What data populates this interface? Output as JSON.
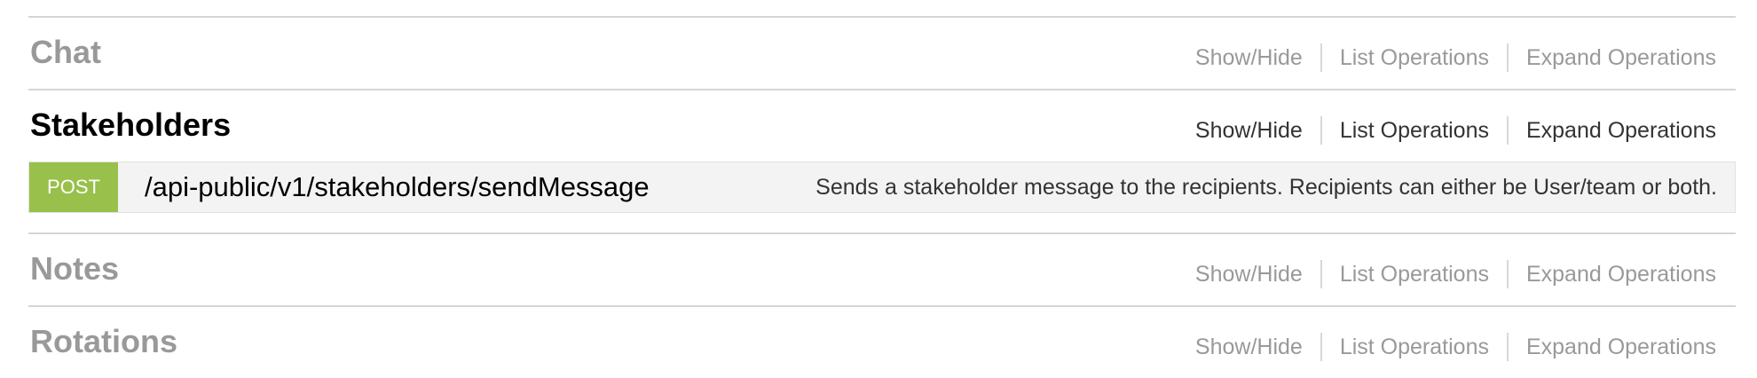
{
  "resources": [
    {
      "title": "Chat",
      "options": {
        "show_hide": "Show/Hide",
        "list_operations": "List Operations",
        "expand_operations": "Expand Operations"
      }
    },
    {
      "title": "Stakeholders",
      "options": {
        "show_hide": "Show/Hide",
        "list_operations": "List Operations",
        "expand_operations": "Expand Operations"
      },
      "endpoints": [
        {
          "method": "POST",
          "path": "/api-public/v1/stakeholders/sendMessage",
          "summary": "Sends a stakeholder message to the recipients. Recipients can either be User/team or both."
        }
      ]
    },
    {
      "title": "Notes",
      "options": {
        "show_hide": "Show/Hide",
        "list_operations": "List Operations",
        "expand_operations": "Expand Operations"
      }
    },
    {
      "title": "Rotations",
      "options": {
        "show_hide": "Show/Hide",
        "list_operations": "List Operations",
        "expand_operations": "Expand Operations"
      }
    }
  ],
  "colors": {
    "post_method": "#98c04a",
    "inactive_text": "#999999",
    "active_title": "#000000",
    "divider": "#d5d5d5"
  }
}
